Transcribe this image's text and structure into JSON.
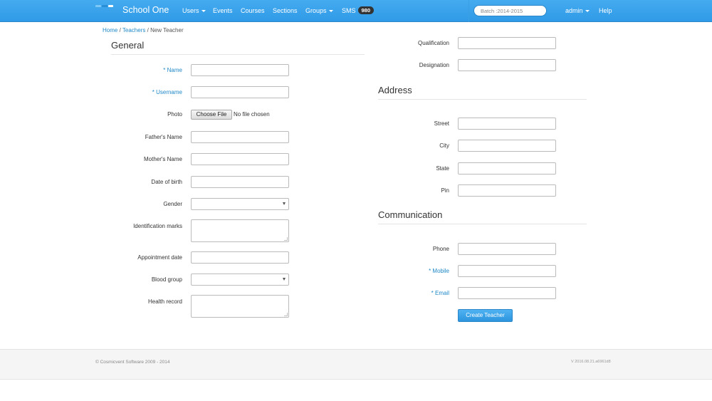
{
  "navbar": {
    "brand": "School One",
    "logo_colors": [
      "#7ec8f7",
      "#2b8fd8",
      "#ffffff"
    ],
    "items": [
      {
        "label": "Users",
        "dropdown": true
      },
      {
        "label": "Events",
        "dropdown": false
      },
      {
        "label": "Courses",
        "dropdown": false
      },
      {
        "label": "Sections",
        "dropdown": false
      },
      {
        "label": "Groups",
        "dropdown": true
      },
      {
        "label": "SMS",
        "badge": "980"
      }
    ],
    "batch_value": "Batch :2014-2015",
    "user_label": "admin",
    "help_label": "Help"
  },
  "breadcrumb": {
    "home": "Home",
    "sep": "/",
    "teachers": "Teachers",
    "current": "New Teacher"
  },
  "general": {
    "title": "General",
    "name_label": "Name",
    "username_label": "Username",
    "photo_label": "Photo",
    "choose_file_label": "Choose File",
    "file_status": "No file chosen",
    "father_label": "Father's Name",
    "mother_label": "Mother's Name",
    "dob_label": "Date of birth",
    "gender_label": "Gender",
    "id_marks_label": "Identification marks",
    "appointment_label": "Appointment date",
    "blood_label": "Blood group",
    "health_label": "Health record"
  },
  "professional": {
    "qualification_label": "Qualification",
    "designation_label": "Designation"
  },
  "address": {
    "title": "Address",
    "street_label": "Street",
    "city_label": "City",
    "state_label": "State",
    "pin_label": "Pin"
  },
  "communication": {
    "title": "Communication",
    "phone_label": "Phone",
    "mobile_label": "Mobile",
    "email_label": "Email",
    "submit_label": "Create Teacher"
  },
  "required_marker": "*",
  "colors": {
    "navbar": "#3aa2ea",
    "link": "#1f88c7",
    "button": "#2c95de"
  },
  "footer": {
    "copyright": "© Cosmicvent Software 2009 - 2014",
    "version": "V 2016.08.21.a6961d8"
  }
}
